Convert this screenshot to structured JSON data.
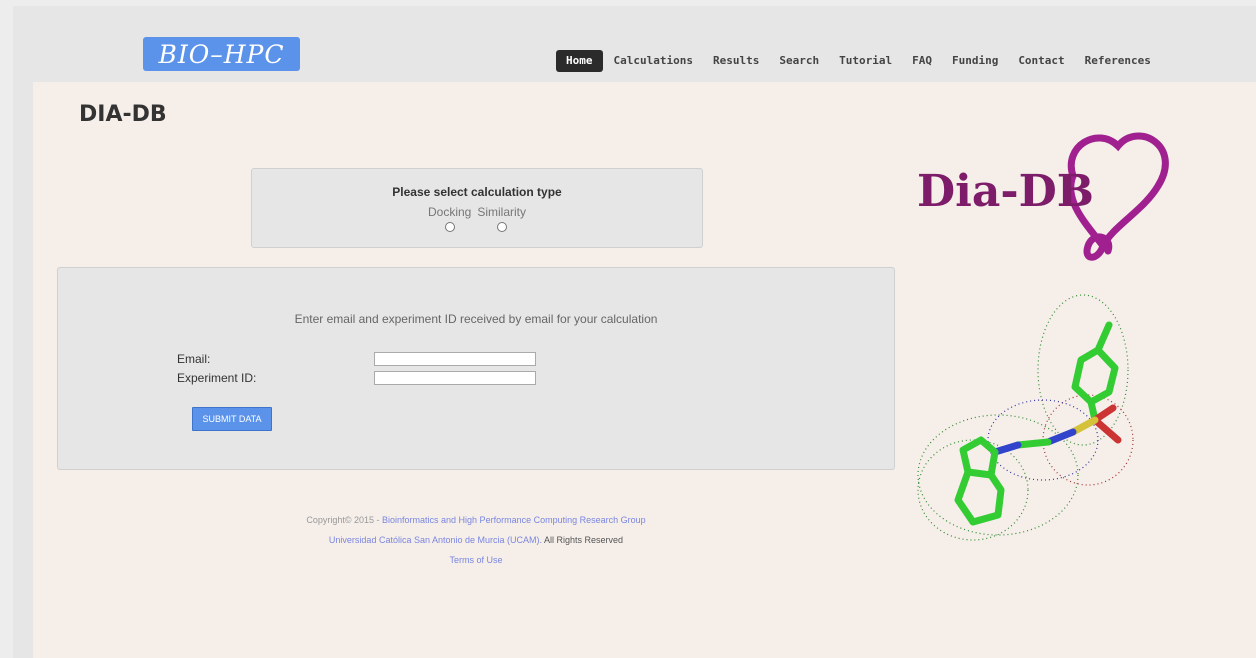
{
  "header": {
    "logo_text": "BIO–HPC",
    "nav": [
      {
        "label": "Home",
        "active": true
      },
      {
        "label": "Calculations"
      },
      {
        "label": "Results"
      },
      {
        "label": "Search"
      },
      {
        "label": "Tutorial"
      },
      {
        "label": "FAQ"
      },
      {
        "label": "Funding"
      },
      {
        "label": "Contact"
      },
      {
        "label": "References"
      }
    ]
  },
  "page": {
    "title": "DIA-DB"
  },
  "calc_type": {
    "title": "Please select calculation type",
    "options": [
      {
        "label": "Docking"
      },
      {
        "label": "Similarity"
      }
    ]
  },
  "form": {
    "instructions": "Enter email and experiment ID received by email for your calculation",
    "email_label": "Email:",
    "email_value": "",
    "experiment_label": "Experiment ID:",
    "experiment_value": "",
    "submit_label": "SUBMIT DATA"
  },
  "footer": {
    "copyright_prefix": "Copyright© 2015 - ",
    "group_link": "Bioinformatics and High Performance Computing Research Group",
    "university_link": "Universidad Católica San Antonio de Murcia (UCAM).",
    "rights": " All Rights Reserved",
    "terms_link": "Terms of Use"
  },
  "side_logo": {
    "text": "Dia-DB",
    "heart_color": "#a0208f",
    "text_color": "#7d1d6a"
  },
  "colors": {
    "accent": "#5b92ea",
    "content_bg": "#f5eee9",
    "nav_active_bg": "#2b2b2b"
  }
}
